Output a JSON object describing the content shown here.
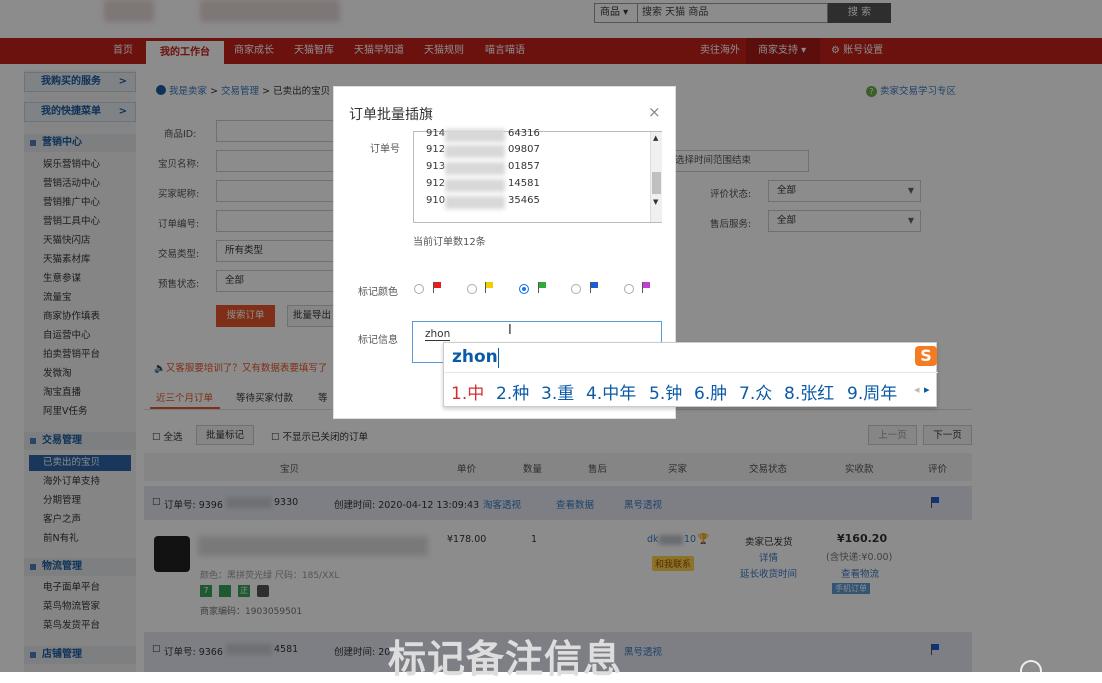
{
  "header": {
    "search_type": "商品 ▾",
    "search_placeholder": "搜索 天猫 商品",
    "search_button": "搜 索"
  },
  "nav": {
    "items": [
      "首页",
      "我的工作台",
      "商家成长",
      "天猫智库",
      "天猫早知道",
      "天猫规则",
      "喵言喵语"
    ],
    "right": [
      "卖往海外",
      "商家支持",
      "账号设置"
    ]
  },
  "sidebar": {
    "top_buttons": [
      "我购买的服务",
      "我的快捷菜单"
    ],
    "groups": [
      {
        "title": "营销中心",
        "items": [
          "娱乐营销中心",
          "营销活动中心",
          "营销推广中心",
          "营销工具中心",
          "天猫快闪店",
          "天猫素材库",
          "生意参谋",
          "流量宝",
          "商家协作填表",
          "自运营中心",
          "拍卖营销平台",
          "发微淘",
          "淘宝直播",
          "阿里V任务"
        ]
      },
      {
        "title": "交易管理",
        "items": [
          "已卖出的宝贝",
          "海外订单支持",
          "分期管理",
          "客户之声",
          "前N有礼"
        ]
      },
      {
        "title": "物流管理",
        "items": [
          "电子面单平台",
          "菜鸟物流管家",
          "菜鸟发货平台"
        ]
      },
      {
        "title": "店铺管理",
        "items": []
      }
    ]
  },
  "breadcrumb": [
    "我是卖家",
    "交易管理",
    "已卖出的宝贝"
  ],
  "help_link": "卖家交易学习专区",
  "filters": {
    "labels": [
      "商品ID:",
      "宝贝名称:",
      "买家昵称:",
      "订单编号:",
      "交易类型:",
      "预售状态:"
    ],
    "trade_type": "所有类型",
    "presale": "全部",
    "time_hint": "选择时间范围结束",
    "rating_label": "评价状态:",
    "rating_value": "全部",
    "aftersale_label": "售后服务:",
    "aftersale_value": "全部",
    "search_button": "搜索订单",
    "batch_export": "批量导出"
  },
  "notice": "又客服要培训了？又有数据表要填写了",
  "tabs": [
    "近三个月订单",
    "等待买家付款",
    "等"
  ],
  "toolbar": {
    "select_all": "全选",
    "batch_mark": "批量标记",
    "hide_closed": "不显示已关闭的订单",
    "prev": "上一页",
    "next": "下一页"
  },
  "columns": [
    "宝贝",
    "单价",
    "数量",
    "售后",
    "买家",
    "交易状态",
    "实收款",
    "评价"
  ],
  "order1": {
    "order_no": "订单号: 9396",
    "order_no_tail": "9330",
    "created": "创建时间: 2020-04-12 13:09:43",
    "links": [
      "淘客透视",
      "查看数据",
      "黑号透视"
    ],
    "color_size": "颜色：黑拼荧光绿  尺码：185/XXL",
    "merchant_code": "商家编码：1903059501",
    "price": "¥178.00",
    "qty": "1",
    "buyer": "dk",
    "buyer_tail": "10",
    "contact": "和我联系",
    "status": [
      "卖家已发货",
      "详情",
      "延长收货时间"
    ],
    "paid": "¥160.20",
    "shipping": "(含快递:¥0.00)",
    "logistics": "查看物流",
    "mobile": "手机订单"
  },
  "order2": {
    "order_no": "订单号: 9366",
    "order_no_tail": "4581",
    "created": "创建时间: 20",
    "link": "黑号透视"
  },
  "dialog": {
    "title": "订单批量插旗",
    "order_label": "订单号",
    "orders": [
      {
        "head": "914",
        "tail": "64316"
      },
      {
        "head": "912",
        "tail": "09807"
      },
      {
        "head": "913",
        "tail": "01857"
      },
      {
        "head": "912",
        "tail": "14581"
      },
      {
        "head": "910",
        "tail": "35465"
      }
    ],
    "count": "当前订单数12条",
    "color_label": "标记颜色",
    "flag_colors": [
      "#e02020",
      "#f0d000",
      "#2eaa3a",
      "#1e5fd0",
      "#c040d0"
    ],
    "selected_flag": 2,
    "note_label": "标记信息",
    "note_value": "zhon"
  },
  "ime": {
    "composition": "zhon",
    "candidates": [
      "1.中",
      "2.种",
      "3.重",
      "4.中年",
      "5.钟",
      "6.肿",
      "7.众",
      "8.张红",
      "9.周年"
    ],
    "logo": "S"
  },
  "caption": "标记备注信息"
}
